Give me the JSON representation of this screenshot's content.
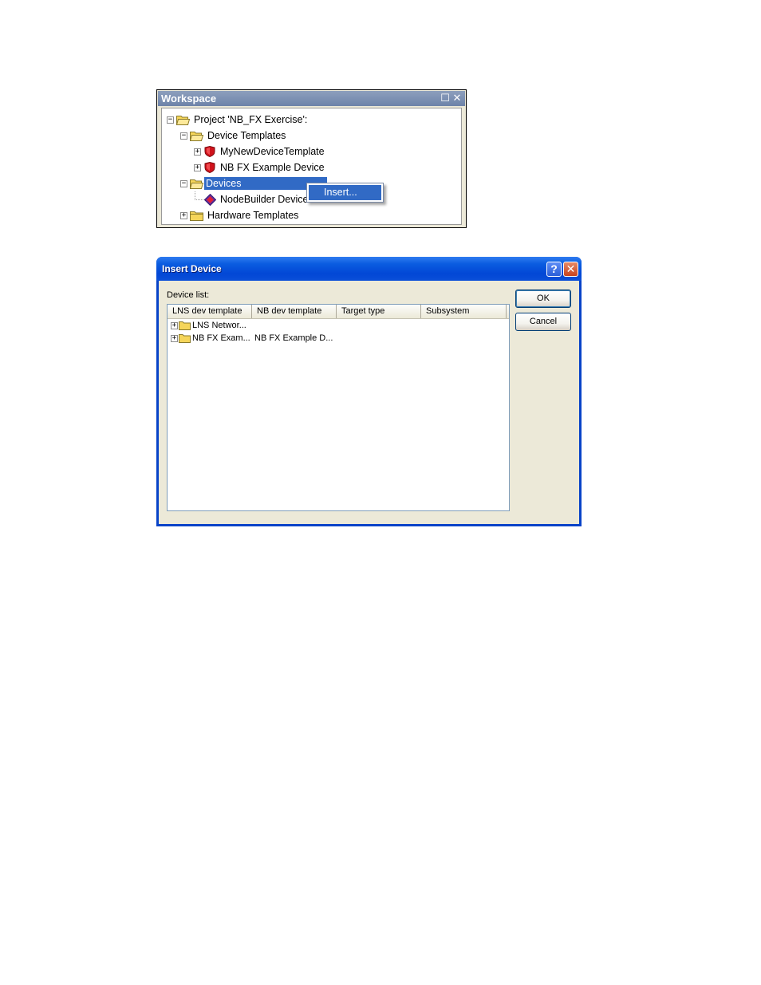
{
  "workspace": {
    "title": "Workspace",
    "restore_glyph": "☐",
    "close_glyph": "✕",
    "tree": [
      {
        "label": "Project 'NB_FX Exercise':",
        "icon": "open-folder-icon",
        "expander": "−"
      },
      {
        "label": "Device Templates",
        "icon": "open-folder-icon",
        "expander": "−"
      },
      {
        "label": "MyNewDeviceTemplate",
        "icon": "red-shield-icon",
        "expander": "+"
      },
      {
        "label": "NB FX Example Device",
        "icon": "red-shield-icon",
        "expander": "+"
      },
      {
        "label": "Devices",
        "icon": "open-folder-icon",
        "expander": "−",
        "selected": true
      },
      {
        "label": "NodeBuilder Device",
        "icon": "device-diamond-icon"
      },
      {
        "label": "Hardware Templates",
        "icon": "folder-icon",
        "expander": "+"
      }
    ],
    "context_menu": {
      "items": [
        "Insert..."
      ]
    }
  },
  "dialog": {
    "title": "Insert Device",
    "help_glyph": "?",
    "close_glyph": "✕",
    "device_list_label": "Device list:",
    "columns": [
      "LNS dev template",
      "NB dev template",
      "Target type",
      "Subsystem"
    ],
    "rows": [
      {
        "lns": "LNS Networ...",
        "nb": "",
        "target": "",
        "subsystem": ""
      },
      {
        "lns": "NB FX Exam...",
        "nb": "NB FX Example D...",
        "target": "",
        "subsystem": ""
      }
    ],
    "ok_label": "OK",
    "cancel_label": "Cancel"
  },
  "colors": {
    "selection": "#316ac5",
    "dialog_frame": "#0843c8",
    "dialog_face": "#ece9d8",
    "workspace_titlebar": "#7b8fb3",
    "shield_red": "#d0121b",
    "folder_yellow": "#f5d55a"
  }
}
